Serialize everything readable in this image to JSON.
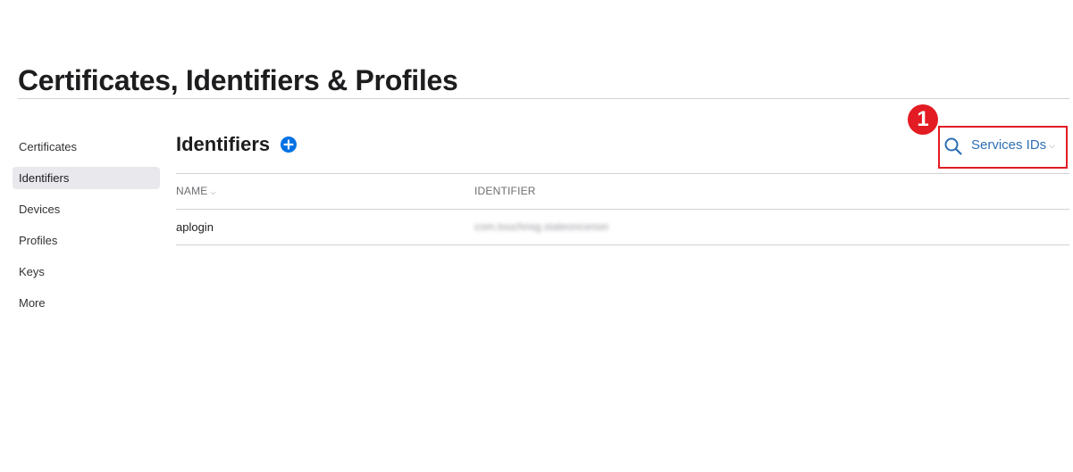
{
  "page": {
    "title": "Certificates, Identifiers & Profiles"
  },
  "sidebar": {
    "items": [
      {
        "label": "Certificates",
        "active": false
      },
      {
        "label": "Identifiers",
        "active": true
      },
      {
        "label": "Devices",
        "active": false
      },
      {
        "label": "Profiles",
        "active": false
      },
      {
        "label": "Keys",
        "active": false
      },
      {
        "label": "More",
        "active": false
      }
    ]
  },
  "main": {
    "section_title": "Identifiers",
    "add_icon": "plus-circle-icon",
    "search_icon": "search-icon",
    "filter": {
      "selected": "Services IDs",
      "chevron": "⌵"
    },
    "annotation": {
      "step": "1",
      "highlight_color": "#e31b23"
    },
    "table": {
      "columns": [
        {
          "label": "NAME",
          "sort_indicator": "⌵"
        },
        {
          "label": "IDENTIFIER"
        }
      ],
      "rows": [
        {
          "name": "aplogin",
          "identifier": "com.touchnsg.stateoncenon"
        }
      ]
    }
  },
  "colors": {
    "accent": "#0071e3",
    "link": "#2d6fb5",
    "annotation": "#e31b23",
    "active_bg": "#e8e8ed",
    "divider": "#d2d2d7"
  }
}
